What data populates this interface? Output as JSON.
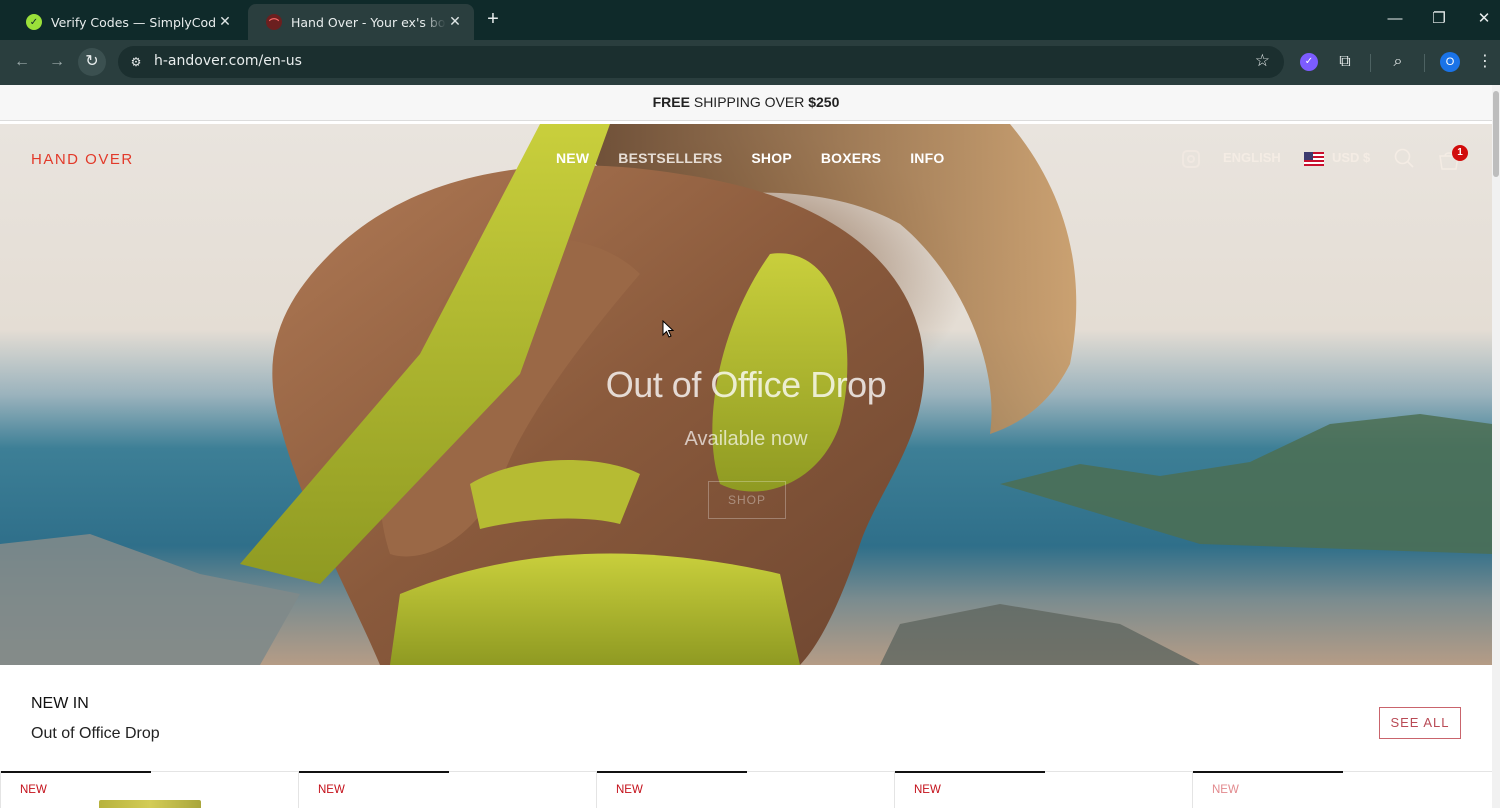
{
  "browser": {
    "tabs": [
      {
        "title": "Verify Codes — SimplyCodes",
        "active": false,
        "favicon": "simplycodes-logo-icon"
      },
      {
        "title": "Hand Over - Your ex's boxers are",
        "active": true,
        "favicon": "handover-logo-icon"
      }
    ],
    "url": "h-andover.com/en-us",
    "profile_initial": "O"
  },
  "announcement": {
    "bold_lead": "FREE",
    "text": " SHIPPING OVER ",
    "bold_tail": "$250"
  },
  "header": {
    "logo": "HAND OVER",
    "nav": [
      "NEW",
      "BESTSELLERS",
      "SHOP",
      "BOXERS",
      "INFO"
    ],
    "language": "ENGLISH",
    "currency": "USD $",
    "cart_count": "1"
  },
  "hero": {
    "title": "Out of Office Drop",
    "subtitle": "Available now",
    "button": "SHOP"
  },
  "section": {
    "label": "NEW IN",
    "title": "Out of Office Drop",
    "see_all": "SEE ALL"
  },
  "products": [
    {
      "badge": "NEW"
    },
    {
      "badge": "NEW"
    },
    {
      "badge": "NEW"
    },
    {
      "badge": "NEW"
    },
    {
      "badge": "NEW"
    }
  ],
  "colors": {
    "brand_red": "#e23a2a",
    "badge_red": "#c4101a",
    "chrome_dark": "#0f2a2a",
    "chrome_toolbar": "#2a3e3e"
  }
}
